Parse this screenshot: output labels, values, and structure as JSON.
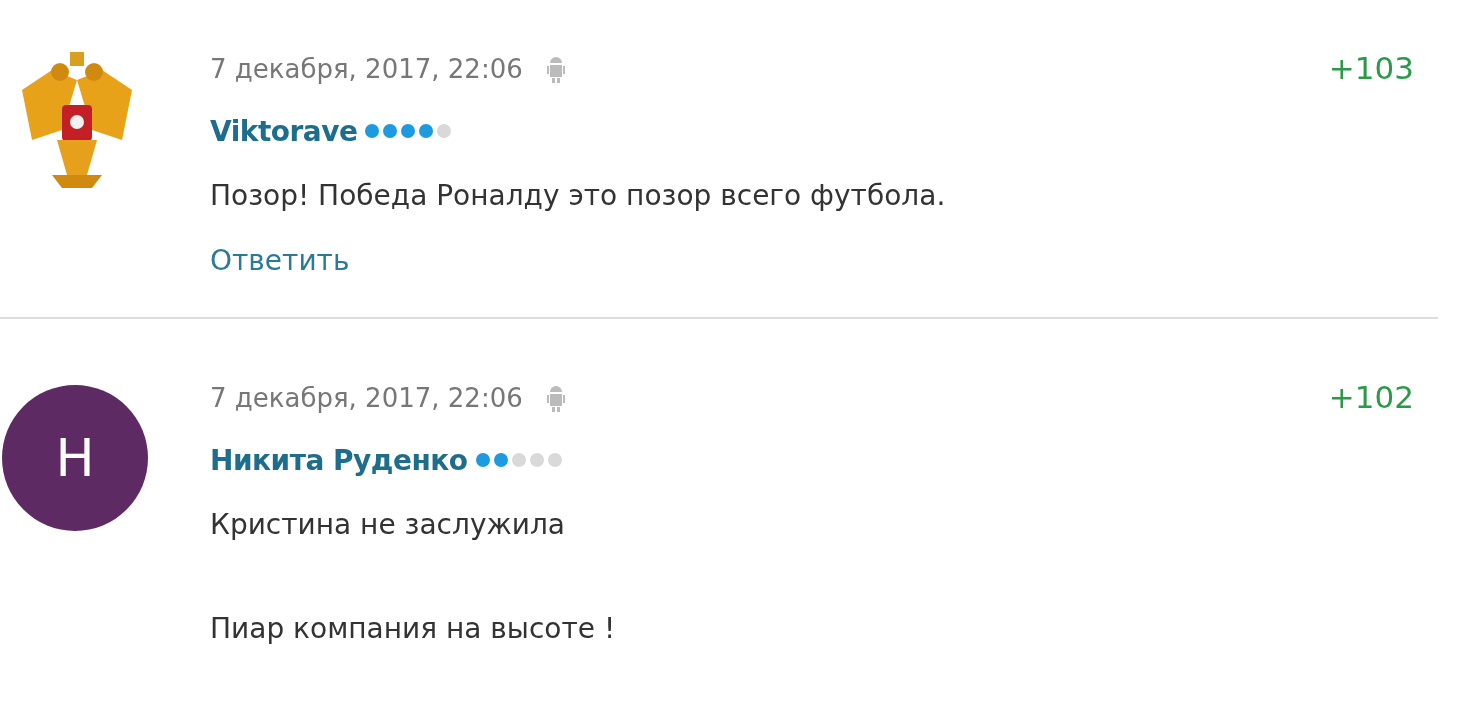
{
  "comments": [
    {
      "avatar": {
        "kind": "emblem"
      },
      "date": "7 декабря, 2017, 22:06",
      "author": "Viktorave",
      "stars": 4,
      "text": "Позор! Победа Роналду это позор всего футбола.",
      "reply": "Ответить",
      "score": "+103"
    },
    {
      "avatar": {
        "kind": "letter",
        "letter": "Н",
        "color": "#5e2a63"
      },
      "date": "7 декабря, 2017, 22:06",
      "author": "Никита Руденко",
      "stars": 2,
      "text": "Кристина не заслужила\n\nПиар компания на высоте !",
      "score": "+102"
    }
  ]
}
